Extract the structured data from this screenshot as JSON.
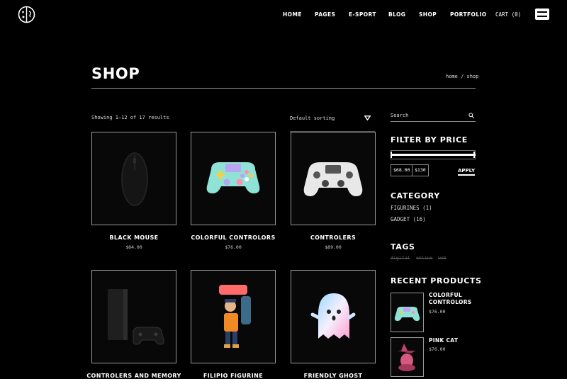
{
  "nav": {
    "items": [
      "HOME",
      "PAGES",
      "E-SPORT",
      "BLOG",
      "SHOP",
      "PORTFOLIO"
    ],
    "cart_label": "CART (0)"
  },
  "page": {
    "title": "SHOP",
    "breadcrumb": "home / shop"
  },
  "toolbar": {
    "result_count": "Showing 1–12 of 17 results",
    "sort_selected": "Default sorting"
  },
  "products": [
    {
      "name": "BLACK MOUSE",
      "price": "$84.00",
      "icon": "mouse"
    },
    {
      "name": "COLORFUL CONTROLORS",
      "price": "$76.00",
      "icon": "gamepad-colorful"
    },
    {
      "name": "CONTROLERS",
      "price": "$89.00",
      "icon": "gamepad-white"
    },
    {
      "name": "CONTROLERS AND MEMORY",
      "price": "",
      "icon": "console"
    },
    {
      "name": "FILIPIO FIGURINE",
      "price": "",
      "icon": "figurine"
    },
    {
      "name": "FRIENDLY GHOST",
      "price": "",
      "icon": "ghost"
    }
  ],
  "sidebar": {
    "search_placeholder": "Search",
    "filter_heading": "FILTER BY PRICE",
    "price_min": "$68.00",
    "price_max": "$130",
    "apply_label": "APPLY",
    "category_heading": "CATEGORY",
    "categories": [
      "FIGURINES (1)",
      "GADGET (16)"
    ],
    "tags_heading": "TAGS",
    "tags": [
      "digital",
      "online",
      "web"
    ],
    "recent_heading": "RECENT PRODUCTS",
    "recent": [
      {
        "name": "COLORFUL CONTROLORS",
        "price": "$76.00",
        "icon": "gamepad-colorful"
      },
      {
        "name": "PINK CAT",
        "price": "$76.00",
        "icon": "cat"
      }
    ]
  },
  "colors": {
    "background": "#000000",
    "text": "#ffffff",
    "border": "#9a9a9a"
  }
}
